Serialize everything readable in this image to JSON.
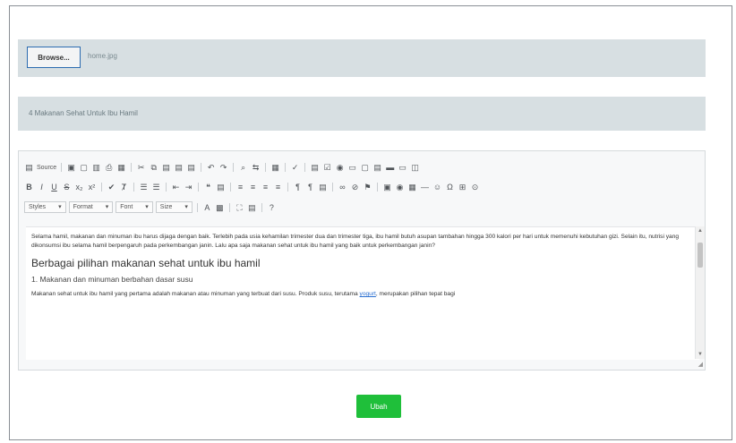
{
  "file_input": {
    "button_label": "Browse...",
    "filename": "home.jpg"
  },
  "title_field": {
    "value": "4 Makanan Sehat Untuk Ibu Hamil"
  },
  "toolbar": {
    "source_label": "Source",
    "styles_label": "Styles",
    "format_label": "Format",
    "font_label": "Font",
    "size_label": "Size"
  },
  "content": {
    "paragraph1": "Selama hamil, makanan dan minuman ibu harus dijaga dengan baik. Terlebih pada usia kehamilan trimester dua dan trimester tiga, ibu hamil butuh asupan tambahan hingga 300 kalori per hari untuk memenuhi kebutuhan gizi. Selain itu, nutrisi yang dikonsumsi ibu selama hamil berpengaruh pada perkembangan janin. Lalu apa saja makanan sehat untuk ibu hamil yang baik untuk perkembangan janin?",
    "heading": "Berbagai pilihan makanan sehat untuk ibu hamil",
    "subheading": "1. Makanan dan minuman berbahan dasar susu",
    "paragraph2_start": "Makanan sehat untuk ibu hamil yang pertama adalah makanan atau minuman yang terbuat dari susu. Produk susu, terutama ",
    "paragraph2_link": "yogurt",
    "paragraph2_end": ", merupakan pilihan tepat bagi"
  },
  "save_button": {
    "label": "Ubah"
  }
}
